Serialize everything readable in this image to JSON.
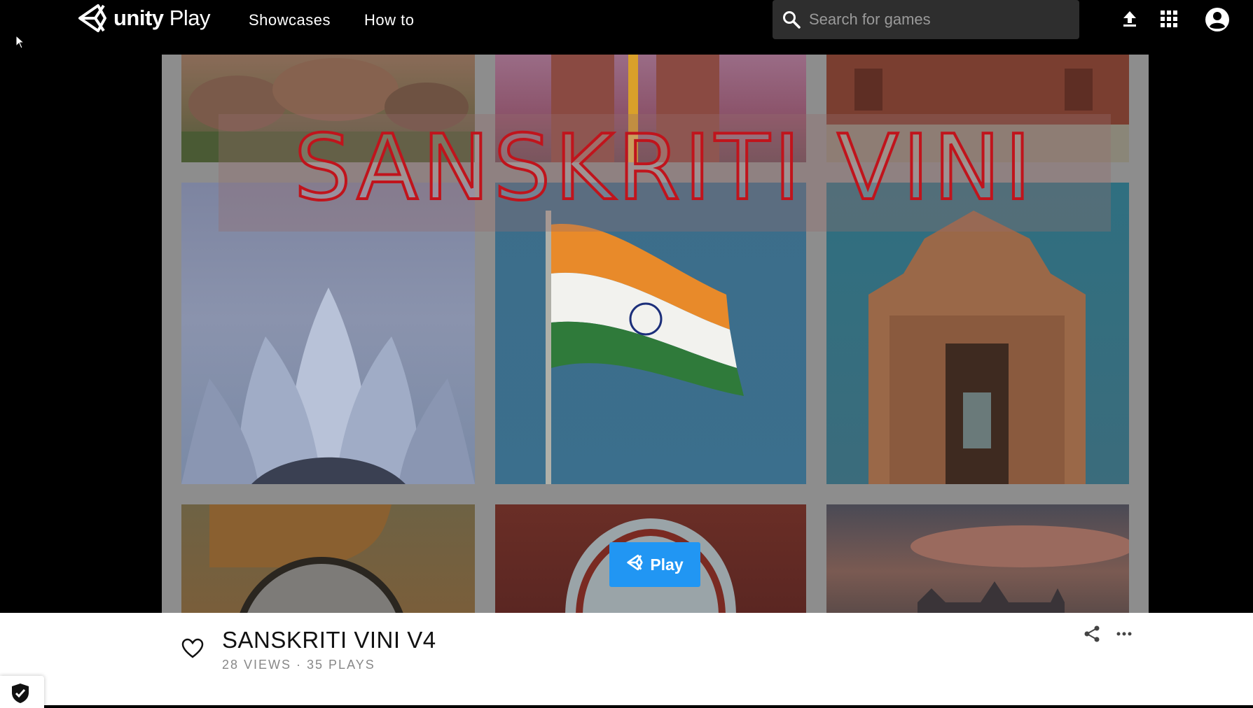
{
  "header": {
    "logo_brand": "unity",
    "logo_product": "Play",
    "nav": [
      "Showcases",
      "How to"
    ],
    "search_placeholder": "Search for games"
  },
  "icons": [
    "unity-logo-icon",
    "search-icon",
    "upload-icon",
    "apps-grid-icon",
    "account-icon",
    "heart-icon",
    "share-icon",
    "more-icon",
    "shield-check-icon",
    "cursor-icon"
  ],
  "game_frame": {
    "title_art": "SANSKRITI VINI",
    "play_label": "Play"
  },
  "game_info": {
    "title": "SANSKRITI VINI V4",
    "stats": "28 VIEWS · 35 PLAYS"
  },
  "colors": {
    "accent": "#2196f3",
    "title_red": "#c0141c",
    "nav_bg": "#000000"
  }
}
